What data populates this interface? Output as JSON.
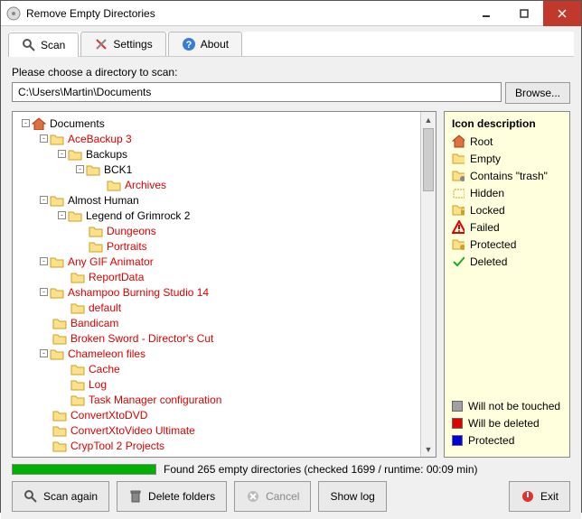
{
  "title": "Remove Empty Directories",
  "tabs": {
    "scan": "Scan",
    "settings": "Settings",
    "about": "About"
  },
  "prompt": "Please choose a directory to scan:",
  "path": "C:\\Users\\Martin\\Documents",
  "browse": "Browse...",
  "tree": [
    {
      "depth": 0,
      "expander": "-",
      "icon": "root",
      "label": "Documents",
      "style": ""
    },
    {
      "depth": 1,
      "expander": "-",
      "icon": "folder",
      "label": "AceBackup 3",
      "style": "red"
    },
    {
      "depth": 2,
      "expander": "-",
      "icon": "folder",
      "label": "Backups",
      "style": ""
    },
    {
      "depth": 3,
      "expander": "-",
      "icon": "folder",
      "label": "BCK1",
      "style": ""
    },
    {
      "depth": 4,
      "expander": "",
      "icon": "folder",
      "label": "Archives",
      "style": "red"
    },
    {
      "depth": 1,
      "expander": "-",
      "icon": "folder",
      "label": "Almost Human",
      "style": ""
    },
    {
      "depth": 2,
      "expander": "-",
      "icon": "folder",
      "label": "Legend of Grimrock 2",
      "style": ""
    },
    {
      "depth": 3,
      "expander": "",
      "icon": "folder",
      "label": "Dungeons",
      "style": "red"
    },
    {
      "depth": 3,
      "expander": "",
      "icon": "folder",
      "label": "Portraits",
      "style": "red"
    },
    {
      "depth": 1,
      "expander": "-",
      "icon": "folder",
      "label": "Any GIF Animator",
      "style": "red"
    },
    {
      "depth": 2,
      "expander": "",
      "icon": "folder",
      "label": "ReportData",
      "style": "red"
    },
    {
      "depth": 1,
      "expander": "-",
      "icon": "folder",
      "label": "Ashampoo Burning Studio 14",
      "style": "red"
    },
    {
      "depth": 2,
      "expander": "",
      "icon": "folder",
      "label": "default",
      "style": "red"
    },
    {
      "depth": 1,
      "expander": "",
      "icon": "folder",
      "label": "Bandicam",
      "style": "red"
    },
    {
      "depth": 1,
      "expander": "",
      "icon": "folder",
      "label": "Broken Sword - Director's Cut",
      "style": "red"
    },
    {
      "depth": 1,
      "expander": "-",
      "icon": "folder",
      "label": "Chameleon files",
      "style": "red"
    },
    {
      "depth": 2,
      "expander": "",
      "icon": "folder",
      "label": "Cache",
      "style": "red"
    },
    {
      "depth": 2,
      "expander": "",
      "icon": "folder",
      "label": "Log",
      "style": "red"
    },
    {
      "depth": 2,
      "expander": "",
      "icon": "folder",
      "label": "Task Manager configuration",
      "style": "red"
    },
    {
      "depth": 1,
      "expander": "",
      "icon": "folder",
      "label": "ConvertXtoDVD",
      "style": "red"
    },
    {
      "depth": 1,
      "expander": "",
      "icon": "folder",
      "label": "ConvertXtoVideo Ultimate",
      "style": "red"
    },
    {
      "depth": 1,
      "expander": "",
      "icon": "folder",
      "label": "CrypTool 2 Projects",
      "style": "red"
    }
  ],
  "legend": {
    "title": "Icon description",
    "items": [
      {
        "icon": "root",
        "label": "Root"
      },
      {
        "icon": "folder",
        "label": "Empty"
      },
      {
        "icon": "trash",
        "label": "Contains \"trash\""
      },
      {
        "icon": "hidden",
        "label": "Hidden"
      },
      {
        "icon": "locked",
        "label": "Locked"
      },
      {
        "icon": "failed",
        "label": "Failed"
      },
      {
        "icon": "protected",
        "label": "Protected"
      },
      {
        "icon": "deleted",
        "label": "Deleted"
      }
    ],
    "colors": [
      {
        "color": "#a0a0a0",
        "label": "Will not be touched"
      },
      {
        "color": "#e00000",
        "label": "Will be deleted"
      },
      {
        "color": "#0000e0",
        "label": "Protected"
      }
    ]
  },
  "status": "Found 265 empty directories (checked 1699 / runtime: 00:09 min)",
  "buttons": {
    "scan": "Scan again",
    "delete": "Delete folders",
    "cancel": "Cancel",
    "showlog": "Show log",
    "exit": "Exit"
  }
}
